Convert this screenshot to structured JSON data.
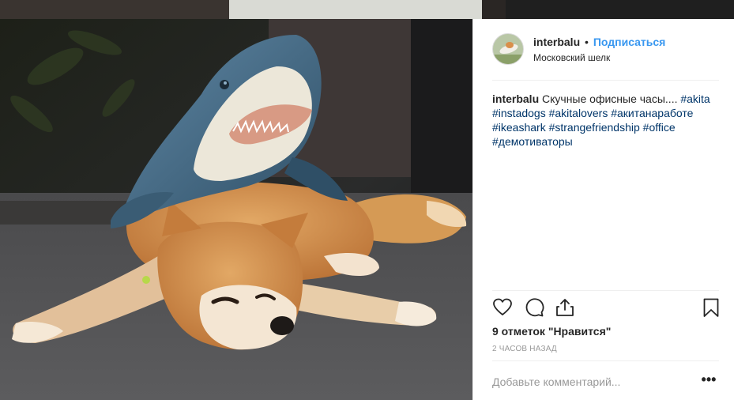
{
  "post": {
    "username": "interbalu",
    "separator": "•",
    "follow_label": "Подписаться",
    "location": "Московский шелк",
    "caption": {
      "username": "interbalu",
      "text": "Скучные офисные часы....",
      "hashtags": [
        "#akita",
        "#instadogs",
        "#akitalovers",
        "#акитанаработе",
        "#ikeashark",
        "#strangefriendship",
        "#office",
        "#демотиваторы"
      ]
    },
    "likes_text": "9 отметок \"Нравится\"",
    "time_ago": "2 часов назад",
    "comment_placeholder": "Добавьте комментарий...",
    "more_label": "•••"
  },
  "icons": {
    "like": "heart-icon",
    "comment": "comment-icon",
    "share": "share-icon",
    "save": "bookmark-icon"
  },
  "colors": {
    "link": "#3897f0",
    "hashtag": "#003569",
    "text": "#262626",
    "muted": "#999999"
  }
}
